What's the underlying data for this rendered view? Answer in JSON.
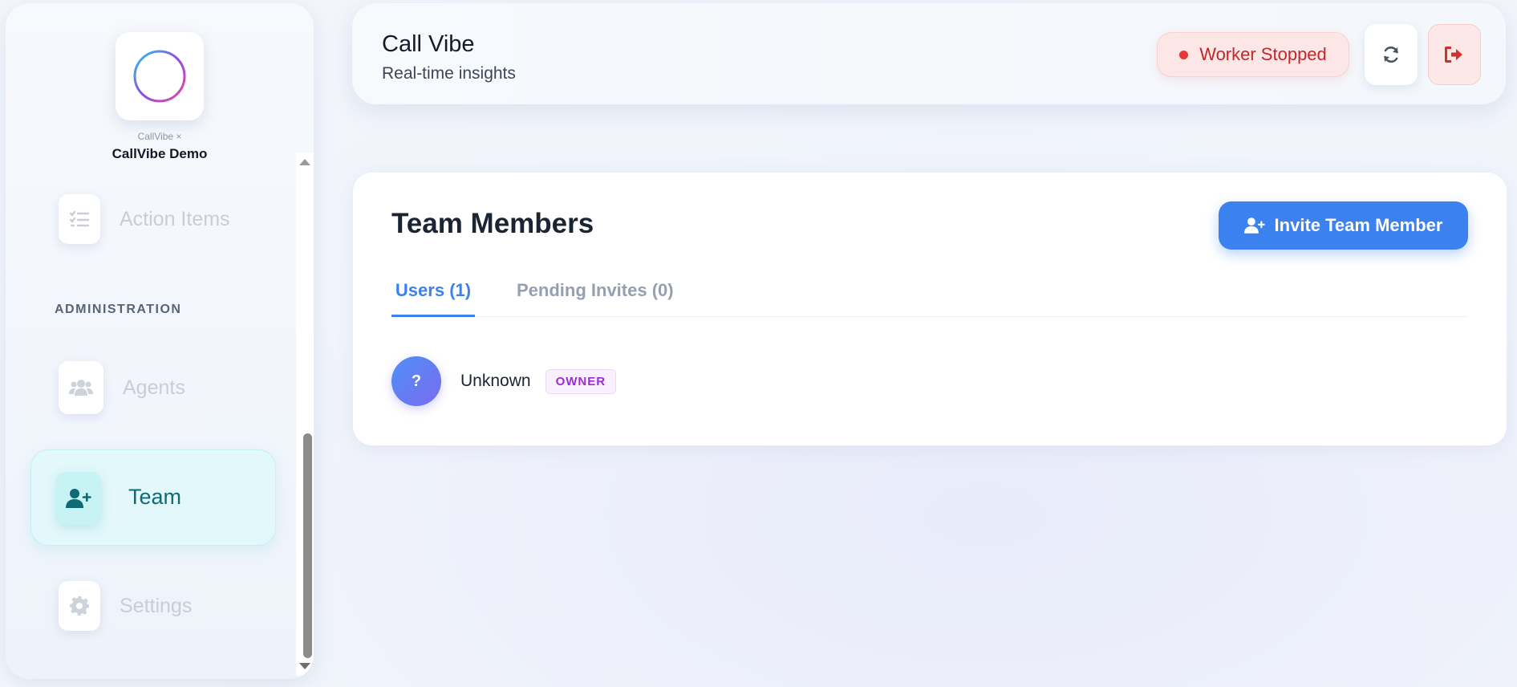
{
  "brand": {
    "subtitle": "CallVibe ×",
    "name": "CallVibe Demo"
  },
  "sidebar": {
    "items": [
      {
        "label": "Action Items",
        "icon": "list-check-icon"
      },
      {
        "label": "Agents",
        "icon": "users-icon"
      },
      {
        "label": "Team",
        "icon": "user-plus-icon",
        "active": true
      },
      {
        "label": "Settings",
        "icon": "gear-icon"
      }
    ],
    "section_admin": "ADMINISTRATION"
  },
  "header": {
    "title": "Call Vibe",
    "subtitle": "Real-time insights",
    "worker_status": "Worker Stopped"
  },
  "team": {
    "title": "Team Members",
    "invite_label": "Invite Team Member",
    "tabs": [
      {
        "label": "Users (1)",
        "active": true
      },
      {
        "label": "Pending Invites (0)",
        "active": false
      }
    ],
    "members": [
      {
        "initial": "?",
        "name": "Unknown",
        "role": "OWNER"
      }
    ]
  },
  "colors": {
    "accent": "#3b82f0",
    "active_nav_bg": "#e2f8fb",
    "active_nav_text": "#0e6a73",
    "worker_stopped": "#c0282b",
    "owner_badge": "#a02ad6"
  }
}
